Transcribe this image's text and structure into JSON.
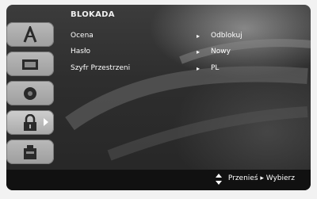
{
  "menu": {
    "title": "BLOKADA",
    "sidebar": [
      {
        "icon": "disc-icon",
        "active": false
      },
      {
        "icon": "screen-icon",
        "active": false
      },
      {
        "icon": "speaker-icon",
        "active": false
      },
      {
        "icon": "lock-icon",
        "active": true
      },
      {
        "icon": "other-icon",
        "active": false
      }
    ],
    "rows": [
      {
        "label": "Ocena",
        "value": "Odblokuj"
      },
      {
        "label": "Hasło",
        "value": "Nowy"
      },
      {
        "label": "Szyfr Przestrzeni",
        "value": "PL"
      }
    ],
    "footer": {
      "hint": "Przenieś ▸ Wybierz"
    }
  }
}
